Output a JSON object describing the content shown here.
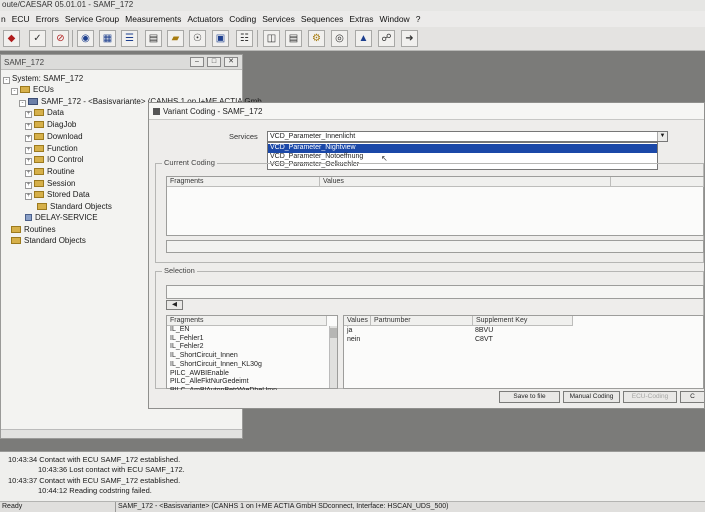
{
  "app": {
    "title": "oute/CAESAR 05.01.01 - SAMF_172"
  },
  "menu": [
    "n",
    "ECU",
    "Errors",
    "Service Group",
    "Measurements",
    "Actuators",
    "Coding",
    "Services",
    "Sequences",
    "Extras",
    "Window",
    "?"
  ],
  "toolbar_icons": [
    "car-icon",
    "check-icon",
    "no-entry-icon",
    "gauge-icon",
    "module-icon",
    "list-icon",
    "panel-icon",
    "folder-icon",
    "eye-icon",
    "chip-icon",
    "document-icon",
    "table-icon",
    "notes-icon",
    "gear-icon",
    "binoculars-icon",
    "bug-icon",
    "plug-icon"
  ],
  "tree_window": {
    "title": "SAMF_172",
    "items": [
      {
        "label": "System: SAMF_172",
        "indent": 0
      },
      {
        "label": "ECUs",
        "indent": 1
      },
      {
        "label": "SAMF_172 - <Basisvariante> (CANHS 1 on I+ME ACTIA Gmb",
        "indent": 2
      },
      {
        "label": "Data",
        "indent": 3
      },
      {
        "label": "DiagJob",
        "indent": 3
      },
      {
        "label": "Download",
        "indent": 3
      },
      {
        "label": "Function",
        "indent": 3
      },
      {
        "label": "IO Control",
        "indent": 3
      },
      {
        "label": "Routine",
        "indent": 3
      },
      {
        "label": "Session",
        "indent": 3
      },
      {
        "label": "Stored Data",
        "indent": 3
      },
      {
        "label": "Standard Objects",
        "indent": 4
      },
      {
        "label": "DELAY-SERVICE",
        "indent": 3
      },
      {
        "label": "Routines",
        "indent": 1
      },
      {
        "label": "Standard Objects",
        "indent": 1
      }
    ]
  },
  "dialog": {
    "title": "Variant Coding - SAMF_172",
    "services_label": "Services",
    "services_value": "VCD_Parameter_Innenlicht",
    "services_options": [
      "VCD_Parameter_Nightview",
      "VCD_Parameter_Notoeffnung",
      "VCD_Parameter_Oelkuehler"
    ],
    "selected_option_index": 0,
    "current_coding_label": "Current Coding",
    "current_coding_headers": [
      "Fragments",
      "Values"
    ],
    "selection_label": "Selection",
    "fragments_header": "Fragments",
    "fragments": [
      "IL_EN",
      "IL_Fehler1",
      "IL_Fehler2",
      "IL_ShortCircuit_Innen",
      "IL_ShortCircuit_Innen_KL30g",
      "PILC_AWBIEnable",
      "PILC_AlleFktNurGedeimt",
      "PILC_AmBlAutonBetrWieDbeUmn"
    ],
    "values_headers": [
      "Values",
      "Partnumber",
      "Supplement Key"
    ],
    "values_rows": [
      {
        "value": "ja",
        "partnumber": "",
        "supplement": "8BVU"
      },
      {
        "value": "nein",
        "partnumber": "",
        "supplement": "C8VT"
      }
    ],
    "buttons": {
      "save": "Save to file",
      "manual": "Manual Coding",
      "ecu": "ECU-Coding",
      "extra": "C"
    }
  },
  "log": [
    {
      "text": "10:43:34 Contact with ECU SAMF_172 established.",
      "indent": 0
    },
    {
      "text": "10:43:36 Lost contact with ECU SAMF_172.",
      "indent": 1
    },
    {
      "text": "10:43:37 Contact with ECU SAMF_172 established.",
      "indent": 0
    },
    {
      "text": "10:44:12 Reading codstring failed.",
      "indent": 1
    }
  ],
  "status": {
    "left": "Ready",
    "center": "SAMF_172 - <Basisvariante> (CANHS 1 on I+ME ACTIA GmbH SDconnect, Interface: HSCAN_UDS_500)"
  },
  "colors": {
    "selection": "#1b48a8",
    "workspace": "#7b7b79",
    "folder": "#d6b04a"
  }
}
